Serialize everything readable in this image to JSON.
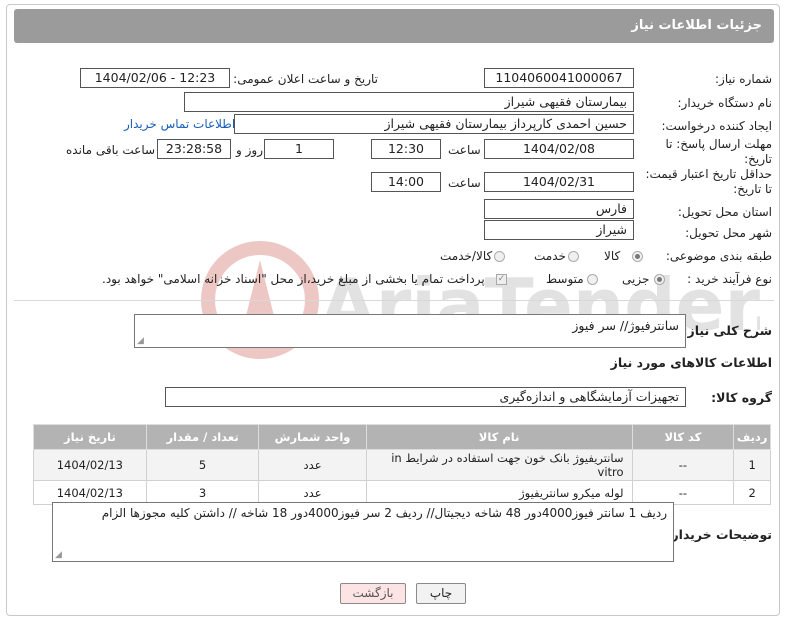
{
  "header": {
    "title": "جزئیات اطلاعات نیاز"
  },
  "watermark": {
    "text": "AriaTender.net"
  },
  "form": {
    "need_number_label": "شماره نیاز:",
    "need_number": "1104060041000067",
    "announce_label": "تاریخ و ساعت اعلان عمومی:",
    "announce_value": "1404/02/06 - 12:23",
    "buyer_org_label": "نام دستگاه خریدار:",
    "buyer_org": "بیمارستان فقیهی شیراز",
    "creator_label": "ایجاد کننده درخواست:",
    "creator": "حسین احمدی کارپرداز بیمارستان فقیهی شیراز",
    "contact_link": "اطلاعات تماس خریدار",
    "deadline_label_1": "مهلت ارسال پاسخ: تا",
    "deadline_label_2": "تاریخ:",
    "deadline_date": "1404/02/08",
    "time_word": "ساعت",
    "deadline_time": "12:30",
    "days_value": "1",
    "days_word": "روز و",
    "remaining_time": "23:28:58",
    "remaining_word": "ساعت باقی مانده",
    "validity_label_1": "حداقل تاریخ اعتبار قیمت:",
    "validity_label_2": "تا تاریخ:",
    "validity_date": "1404/02/31",
    "validity_time": "14:00",
    "province_label": "استان محل تحویل:",
    "province": "فارس",
    "city_label": "شهر محل تحویل:",
    "city": "شیراز",
    "category_label": "طبقه بندی موضوعی:",
    "category_options": [
      "کالا",
      "خدمت",
      "کالا/خدمت"
    ],
    "category_selected": "کالا",
    "process_label": "نوع فرآیند خرید :",
    "process_options": [
      "جزیی",
      "متوسط"
    ],
    "process_selected": "جزیی",
    "payment_note": "پرداخت تمام یا بخشی از مبلغ خرید،از محل \"اسناد خزانه اسلامی\" خواهد بود."
  },
  "description": {
    "label": "شرح کلی نیاز:",
    "value": "سانترفیوژ// سر فیوز"
  },
  "goods": {
    "section_title": "اطلاعات کالاهای مورد نیاز",
    "group_label": "گروه کالا:",
    "group_value": "تجهیزات آزمایشگاهی و اندازه‌گیری",
    "columns": [
      "ردیف",
      "کد کالا",
      "نام کالا",
      "واحد شمارش",
      "تعداد / مقدار",
      "تاریخ نیاز"
    ],
    "rows": [
      {
        "row": "1",
        "code": "--",
        "name": "سانتریفیوژ بانک خون جهت استفاده در شرایط in vitro",
        "unit": "عدد",
        "qty": "5",
        "date": "1404/02/13"
      },
      {
        "row": "2",
        "code": "--",
        "name": "لوله میکرو سانتریفیوژ",
        "unit": "عدد",
        "qty": "3",
        "date": "1404/02/13"
      }
    ]
  },
  "buyer_notes": {
    "label": "توضیحات خریدار:",
    "value": "ردیف 1 سانتر فیوز4000دور 48 شاخه دیجیتال// ردیف 2  سر فیوز4000دور 18 شاخه // داشتن کلیه مجوزها الزام"
  },
  "buttons": {
    "print": "چاپ",
    "back": "بازگشت"
  }
}
